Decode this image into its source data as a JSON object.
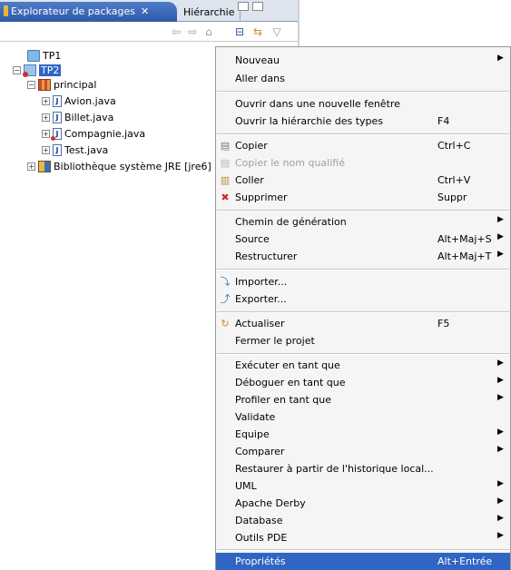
{
  "tabs": {
    "active_label": "Explorateur de packages",
    "close_glyph": "✕",
    "inactive_label": "Hiérarchie"
  },
  "toolbar": {
    "back_icon": "⇦",
    "forward_icon": "⇨",
    "home_icon": "⌂",
    "collapse_icon": "⊟",
    "link_icon": "⇆",
    "menu_icon": "▽"
  },
  "tree": {
    "tp1": "TP1",
    "tp2": "TP2",
    "principal": "principal",
    "avion": "Avion.java",
    "billet": "Billet.java",
    "compagnie": "Compagnie.java",
    "test": "Test.java",
    "jre": "Bibliothèque système JRE [jre6]",
    "java_glyph": "J"
  },
  "menu": {
    "nouveau": "Nouveau",
    "aller_dans": "Aller dans",
    "ouvrir_fenetre": "Ouvrir dans une nouvelle fenêtre",
    "ouvrir_hierarchie": "Ouvrir la hiérarchie des types",
    "ouvrir_hierarchie_sc": "F4",
    "copier": "Copier",
    "copier_sc": "Ctrl+C",
    "copier_nom": "Copier le nom qualifié",
    "coller": "Coller",
    "coller_sc": "Ctrl+V",
    "supprimer": "Supprimer",
    "supprimer_sc": "Suppr",
    "chemin": "Chemin de génération",
    "source": "Source",
    "source_sc": "Alt+Maj+S",
    "restructurer": "Restructurer",
    "restructurer_sc": "Alt+Maj+T",
    "importer": "Importer...",
    "exporter": "Exporter...",
    "actualiser": "Actualiser",
    "actualiser_sc": "F5",
    "fermer": "Fermer le projet",
    "executer": "Exécuter en tant que",
    "deboguer": "Déboguer en tant que",
    "profiler": "Profiler en tant que",
    "validate": "Validate",
    "equipe": "Equipe",
    "comparer": "Comparer",
    "restaurer": "Restaurer à partir de l'historique local...",
    "uml": "UML",
    "derby": "Apache Derby",
    "database": "Database",
    "outils_pde": "Outils PDE",
    "proprietes": "Propriétés",
    "proprietes_sc": "Alt+Entrée",
    "arrow": "▶",
    "icons": {
      "copy": "▤",
      "paste": "▥",
      "delete": "✖",
      "import": "⤵",
      "export": "⤴",
      "refresh": "↻"
    }
  },
  "colors": {
    "selection": "#3165c4",
    "menu_bg": "#f5f5f5",
    "delete_red": "#d42a2a"
  }
}
